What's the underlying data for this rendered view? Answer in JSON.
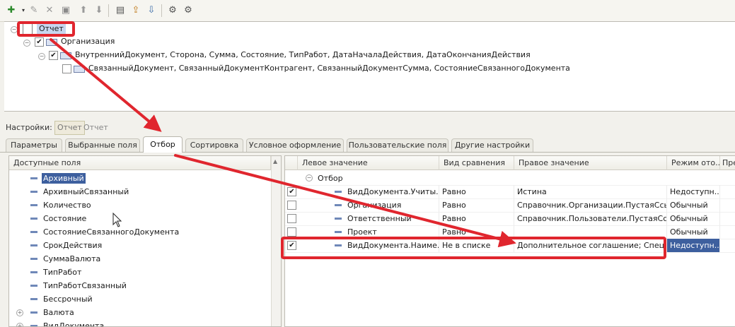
{
  "toolbar": {
    "icons": [
      "add-icon",
      "pencil-icon",
      "delete-icon",
      "edit-icon",
      "move-up-icon",
      "move-down-icon",
      "report-icon",
      "upload-icon",
      "download-icon",
      "settings-icon",
      "structure-icon"
    ]
  },
  "tree": {
    "root_label": "Отчет",
    "org_label": "Организация",
    "child1_label": "ВнутреннийДокумент, Сторона, Сумма, Состояние, ТипРабот, ДатаНачалаДействия, ДатаОкончанияДействия",
    "child2_label": "СвязанныйДокумент, СвязанныйДокументКонтрагент, СвязанныйДокументСумма, СостояниеСвязанногоДокумента"
  },
  "settings": {
    "label": "Настройки:",
    "btn1": "Отчет",
    "btn2": "Отчет"
  },
  "tabs": [
    "Параметры",
    "Выбранные поля",
    "Отбор",
    "Сортировка",
    "Условное оформление",
    "Пользовательские поля",
    "Другие настройки"
  ],
  "fields_panel": {
    "header": "Доступные поля",
    "items": [
      "Архивный",
      "АрхивныйСвязанный",
      "Количество",
      "Состояние",
      "СостояниеСвязанногоДокумента",
      "СрокДействия",
      "СуммаВалюта",
      "ТипРабот",
      "ТипРаботСвязанный",
      "Бессрочный",
      "Валюта",
      "ВидДокумента"
    ]
  },
  "filter_table": {
    "headers": [
      "Левое значение",
      "Вид сравнения",
      "Правое значение",
      "Режим ото...",
      "Пре"
    ],
    "group_label": "Отбор",
    "rows": [
      {
        "checked": true,
        "left": "ВидДокумента.Учиты...",
        "cmp": "Равно",
        "right": "Истина",
        "mode": "Недоступн..."
      },
      {
        "checked": false,
        "left": "Организация",
        "cmp": "Равно",
        "right": "Справочник.Организации.ПустаяСсылка",
        "mode": "Обычный"
      },
      {
        "checked": false,
        "left": "Ответственный",
        "cmp": "Равно",
        "right": "Справочник.Пользователи.ПустаяСсы...",
        "mode": "Обычный"
      },
      {
        "checked": false,
        "left": "Проект",
        "cmp": "Равно",
        "right": "",
        "mode": "Обычный"
      },
      {
        "checked": true,
        "left": "ВидДокумента.Наиме...",
        "cmp": "Не в списке",
        "right": "Дополнительное соглашение; Специф...",
        "mode": "Недоступн..."
      }
    ]
  },
  "colors": {
    "annotation": "#e0262e",
    "selection": "#3d5f9e",
    "selection_light": "#c7d6ef"
  }
}
